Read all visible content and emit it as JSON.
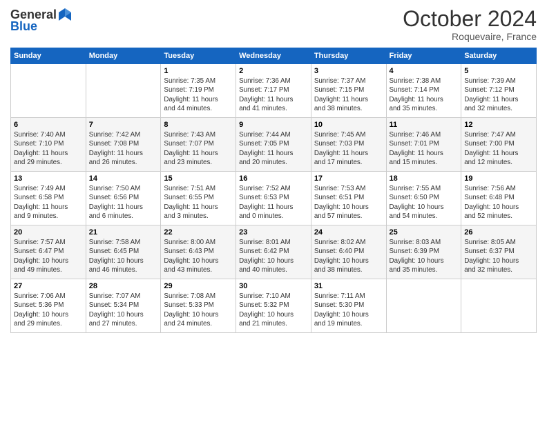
{
  "header": {
    "logo_line1": "General",
    "logo_line2": "Blue",
    "month": "October 2024",
    "location": "Roquevaire, France"
  },
  "weekdays": [
    "Sunday",
    "Monday",
    "Tuesday",
    "Wednesday",
    "Thursday",
    "Friday",
    "Saturday"
  ],
  "weeks": [
    [
      {
        "day": "",
        "info": ""
      },
      {
        "day": "",
        "info": ""
      },
      {
        "day": "1",
        "info": "Sunrise: 7:35 AM\nSunset: 7:19 PM\nDaylight: 11 hours\nand 44 minutes."
      },
      {
        "day": "2",
        "info": "Sunrise: 7:36 AM\nSunset: 7:17 PM\nDaylight: 11 hours\nand 41 minutes."
      },
      {
        "day": "3",
        "info": "Sunrise: 7:37 AM\nSunset: 7:15 PM\nDaylight: 11 hours\nand 38 minutes."
      },
      {
        "day": "4",
        "info": "Sunrise: 7:38 AM\nSunset: 7:14 PM\nDaylight: 11 hours\nand 35 minutes."
      },
      {
        "day": "5",
        "info": "Sunrise: 7:39 AM\nSunset: 7:12 PM\nDaylight: 11 hours\nand 32 minutes."
      }
    ],
    [
      {
        "day": "6",
        "info": "Sunrise: 7:40 AM\nSunset: 7:10 PM\nDaylight: 11 hours\nand 29 minutes."
      },
      {
        "day": "7",
        "info": "Sunrise: 7:42 AM\nSunset: 7:08 PM\nDaylight: 11 hours\nand 26 minutes."
      },
      {
        "day": "8",
        "info": "Sunrise: 7:43 AM\nSunset: 7:07 PM\nDaylight: 11 hours\nand 23 minutes."
      },
      {
        "day": "9",
        "info": "Sunrise: 7:44 AM\nSunset: 7:05 PM\nDaylight: 11 hours\nand 20 minutes."
      },
      {
        "day": "10",
        "info": "Sunrise: 7:45 AM\nSunset: 7:03 PM\nDaylight: 11 hours\nand 17 minutes."
      },
      {
        "day": "11",
        "info": "Sunrise: 7:46 AM\nSunset: 7:01 PM\nDaylight: 11 hours\nand 15 minutes."
      },
      {
        "day": "12",
        "info": "Sunrise: 7:47 AM\nSunset: 7:00 PM\nDaylight: 11 hours\nand 12 minutes."
      }
    ],
    [
      {
        "day": "13",
        "info": "Sunrise: 7:49 AM\nSunset: 6:58 PM\nDaylight: 11 hours\nand 9 minutes."
      },
      {
        "day": "14",
        "info": "Sunrise: 7:50 AM\nSunset: 6:56 PM\nDaylight: 11 hours\nand 6 minutes."
      },
      {
        "day": "15",
        "info": "Sunrise: 7:51 AM\nSunset: 6:55 PM\nDaylight: 11 hours\nand 3 minutes."
      },
      {
        "day": "16",
        "info": "Sunrise: 7:52 AM\nSunset: 6:53 PM\nDaylight: 11 hours\nand 0 minutes."
      },
      {
        "day": "17",
        "info": "Sunrise: 7:53 AM\nSunset: 6:51 PM\nDaylight: 10 hours\nand 57 minutes."
      },
      {
        "day": "18",
        "info": "Sunrise: 7:55 AM\nSunset: 6:50 PM\nDaylight: 10 hours\nand 54 minutes."
      },
      {
        "day": "19",
        "info": "Sunrise: 7:56 AM\nSunset: 6:48 PM\nDaylight: 10 hours\nand 52 minutes."
      }
    ],
    [
      {
        "day": "20",
        "info": "Sunrise: 7:57 AM\nSunset: 6:47 PM\nDaylight: 10 hours\nand 49 minutes."
      },
      {
        "day": "21",
        "info": "Sunrise: 7:58 AM\nSunset: 6:45 PM\nDaylight: 10 hours\nand 46 minutes."
      },
      {
        "day": "22",
        "info": "Sunrise: 8:00 AM\nSunset: 6:43 PM\nDaylight: 10 hours\nand 43 minutes."
      },
      {
        "day": "23",
        "info": "Sunrise: 8:01 AM\nSunset: 6:42 PM\nDaylight: 10 hours\nand 40 minutes."
      },
      {
        "day": "24",
        "info": "Sunrise: 8:02 AM\nSunset: 6:40 PM\nDaylight: 10 hours\nand 38 minutes."
      },
      {
        "day": "25",
        "info": "Sunrise: 8:03 AM\nSunset: 6:39 PM\nDaylight: 10 hours\nand 35 minutes."
      },
      {
        "day": "26",
        "info": "Sunrise: 8:05 AM\nSunset: 6:37 PM\nDaylight: 10 hours\nand 32 minutes."
      }
    ],
    [
      {
        "day": "27",
        "info": "Sunrise: 7:06 AM\nSunset: 5:36 PM\nDaylight: 10 hours\nand 29 minutes."
      },
      {
        "day": "28",
        "info": "Sunrise: 7:07 AM\nSunset: 5:34 PM\nDaylight: 10 hours\nand 27 minutes."
      },
      {
        "day": "29",
        "info": "Sunrise: 7:08 AM\nSunset: 5:33 PM\nDaylight: 10 hours\nand 24 minutes."
      },
      {
        "day": "30",
        "info": "Sunrise: 7:10 AM\nSunset: 5:32 PM\nDaylight: 10 hours\nand 21 minutes."
      },
      {
        "day": "31",
        "info": "Sunrise: 7:11 AM\nSunset: 5:30 PM\nDaylight: 10 hours\nand 19 minutes."
      },
      {
        "day": "",
        "info": ""
      },
      {
        "day": "",
        "info": ""
      }
    ]
  ]
}
